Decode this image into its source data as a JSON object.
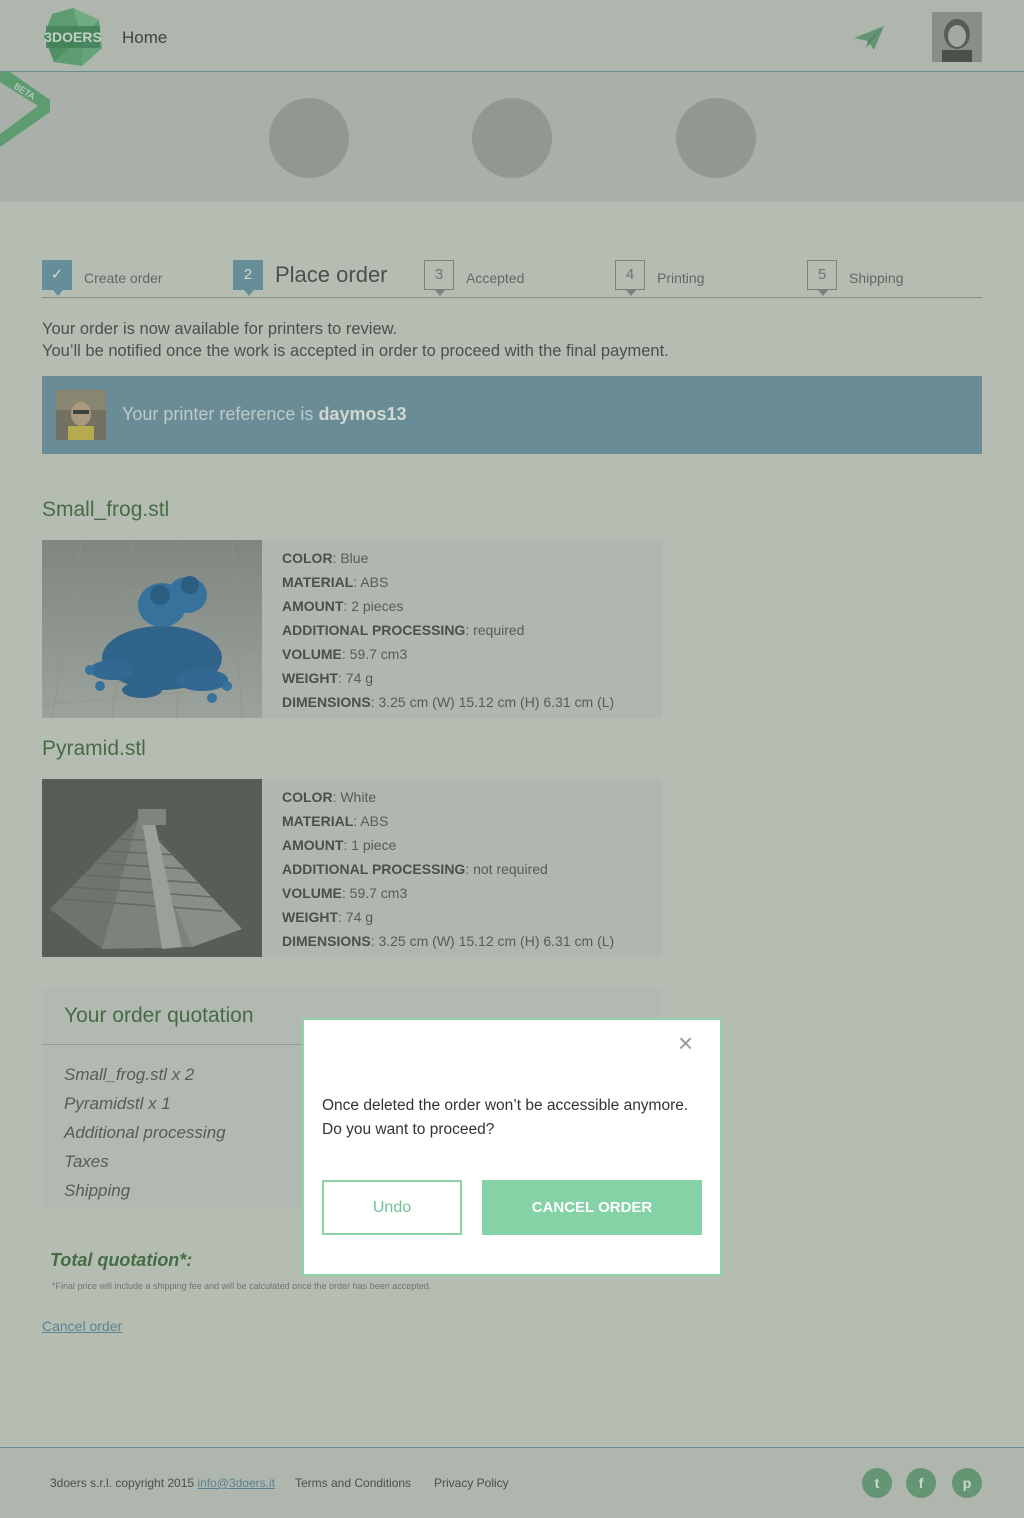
{
  "header": {
    "logo_text": "3DOERS",
    "home_label": "Home"
  },
  "beta_label": "BETA",
  "steps": [
    {
      "num": "✓",
      "label": "Create order"
    },
    {
      "num": "2",
      "label": "Place order"
    },
    {
      "num": "3",
      "label": "Accepted"
    },
    {
      "num": "4",
      "label": "Printing"
    },
    {
      "num": "5",
      "label": "Shipping"
    }
  ],
  "intro": {
    "line1": "Your order is now available for printers to review.",
    "line2": "You’ll be notified once the work is accepted in order to proceed with the final payment."
  },
  "printer": {
    "prefix": "Your printer reference is ",
    "name": "daymos13"
  },
  "files": [
    {
      "title": "Small_frog.stl",
      "specs": [
        {
          "key": "COLOR",
          "value": " Blue"
        },
        {
          "key": "MATERIAL",
          "value": " ABS"
        },
        {
          "key": "AMOUNT",
          "value": "  2 pieces"
        },
        {
          "key": "ADDITIONAL PROCESSING",
          "value": "  required"
        },
        {
          "key": "VOLUME",
          "value": " 59.7 cm3"
        },
        {
          "key": "WEIGHT",
          "value": " 74 g"
        },
        {
          "key": "DIMENSIONS",
          "value": " 3.25 cm (W) 15.12 cm (H) 6.31 cm (L)"
        }
      ]
    },
    {
      "title": "Pyramid.stl",
      "specs": [
        {
          "key": "COLOR",
          "value": " White"
        },
        {
          "key": "MATERIAL",
          "value": " ABS"
        },
        {
          "key": "AMOUNT",
          "value": "  1 piece"
        },
        {
          "key": "ADDITIONAL PROCESSING",
          "value": "  not required"
        },
        {
          "key": "VOLUME",
          "value": " 59.7 cm3"
        },
        {
          "key": "WEIGHT",
          "value": " 74 g"
        },
        {
          "key": "DIMENSIONS",
          "value": " 3.25 cm (W) 15.12 cm (H) 6.31 cm (L)"
        }
      ]
    }
  ],
  "quotation": {
    "title": "Your order quotation",
    "items": [
      "Small_frog.stl x 2",
      "Pyramidstl x 1",
      "Additional processing",
      "Taxes",
      "Shipping"
    ],
    "total_label": "Total quotation*:",
    "note": "*Final price will include a shipping fee and will be calculated once the order has been accepted.",
    "cancel_link": "Cancel order"
  },
  "footer": {
    "copyright": "3doers s.r.l. copyright 2015 ",
    "email": "info@3doers.it",
    "terms": "Terms and Conditions",
    "privacy": "Privacy Policy",
    "social": [
      {
        "icon": "twitter-icon",
        "glyph": "t"
      },
      {
        "icon": "facebook-icon",
        "glyph": "f"
      },
      {
        "icon": "pinterest-icon",
        "glyph": "p"
      }
    ]
  },
  "modal": {
    "close": "×",
    "message_line1": "Once deleted the order won’t be accessible anymore.",
    "message_line2": "Do you want to proceed?",
    "undo_label": "Undo",
    "cancel_label": "CANCEL ORDER"
  },
  "colors": {
    "accent_green": "#84d2a6",
    "step_blue": "#6a9ab0",
    "printer_bar": "#6f97ad",
    "title_green": "#3e6b3e"
  }
}
